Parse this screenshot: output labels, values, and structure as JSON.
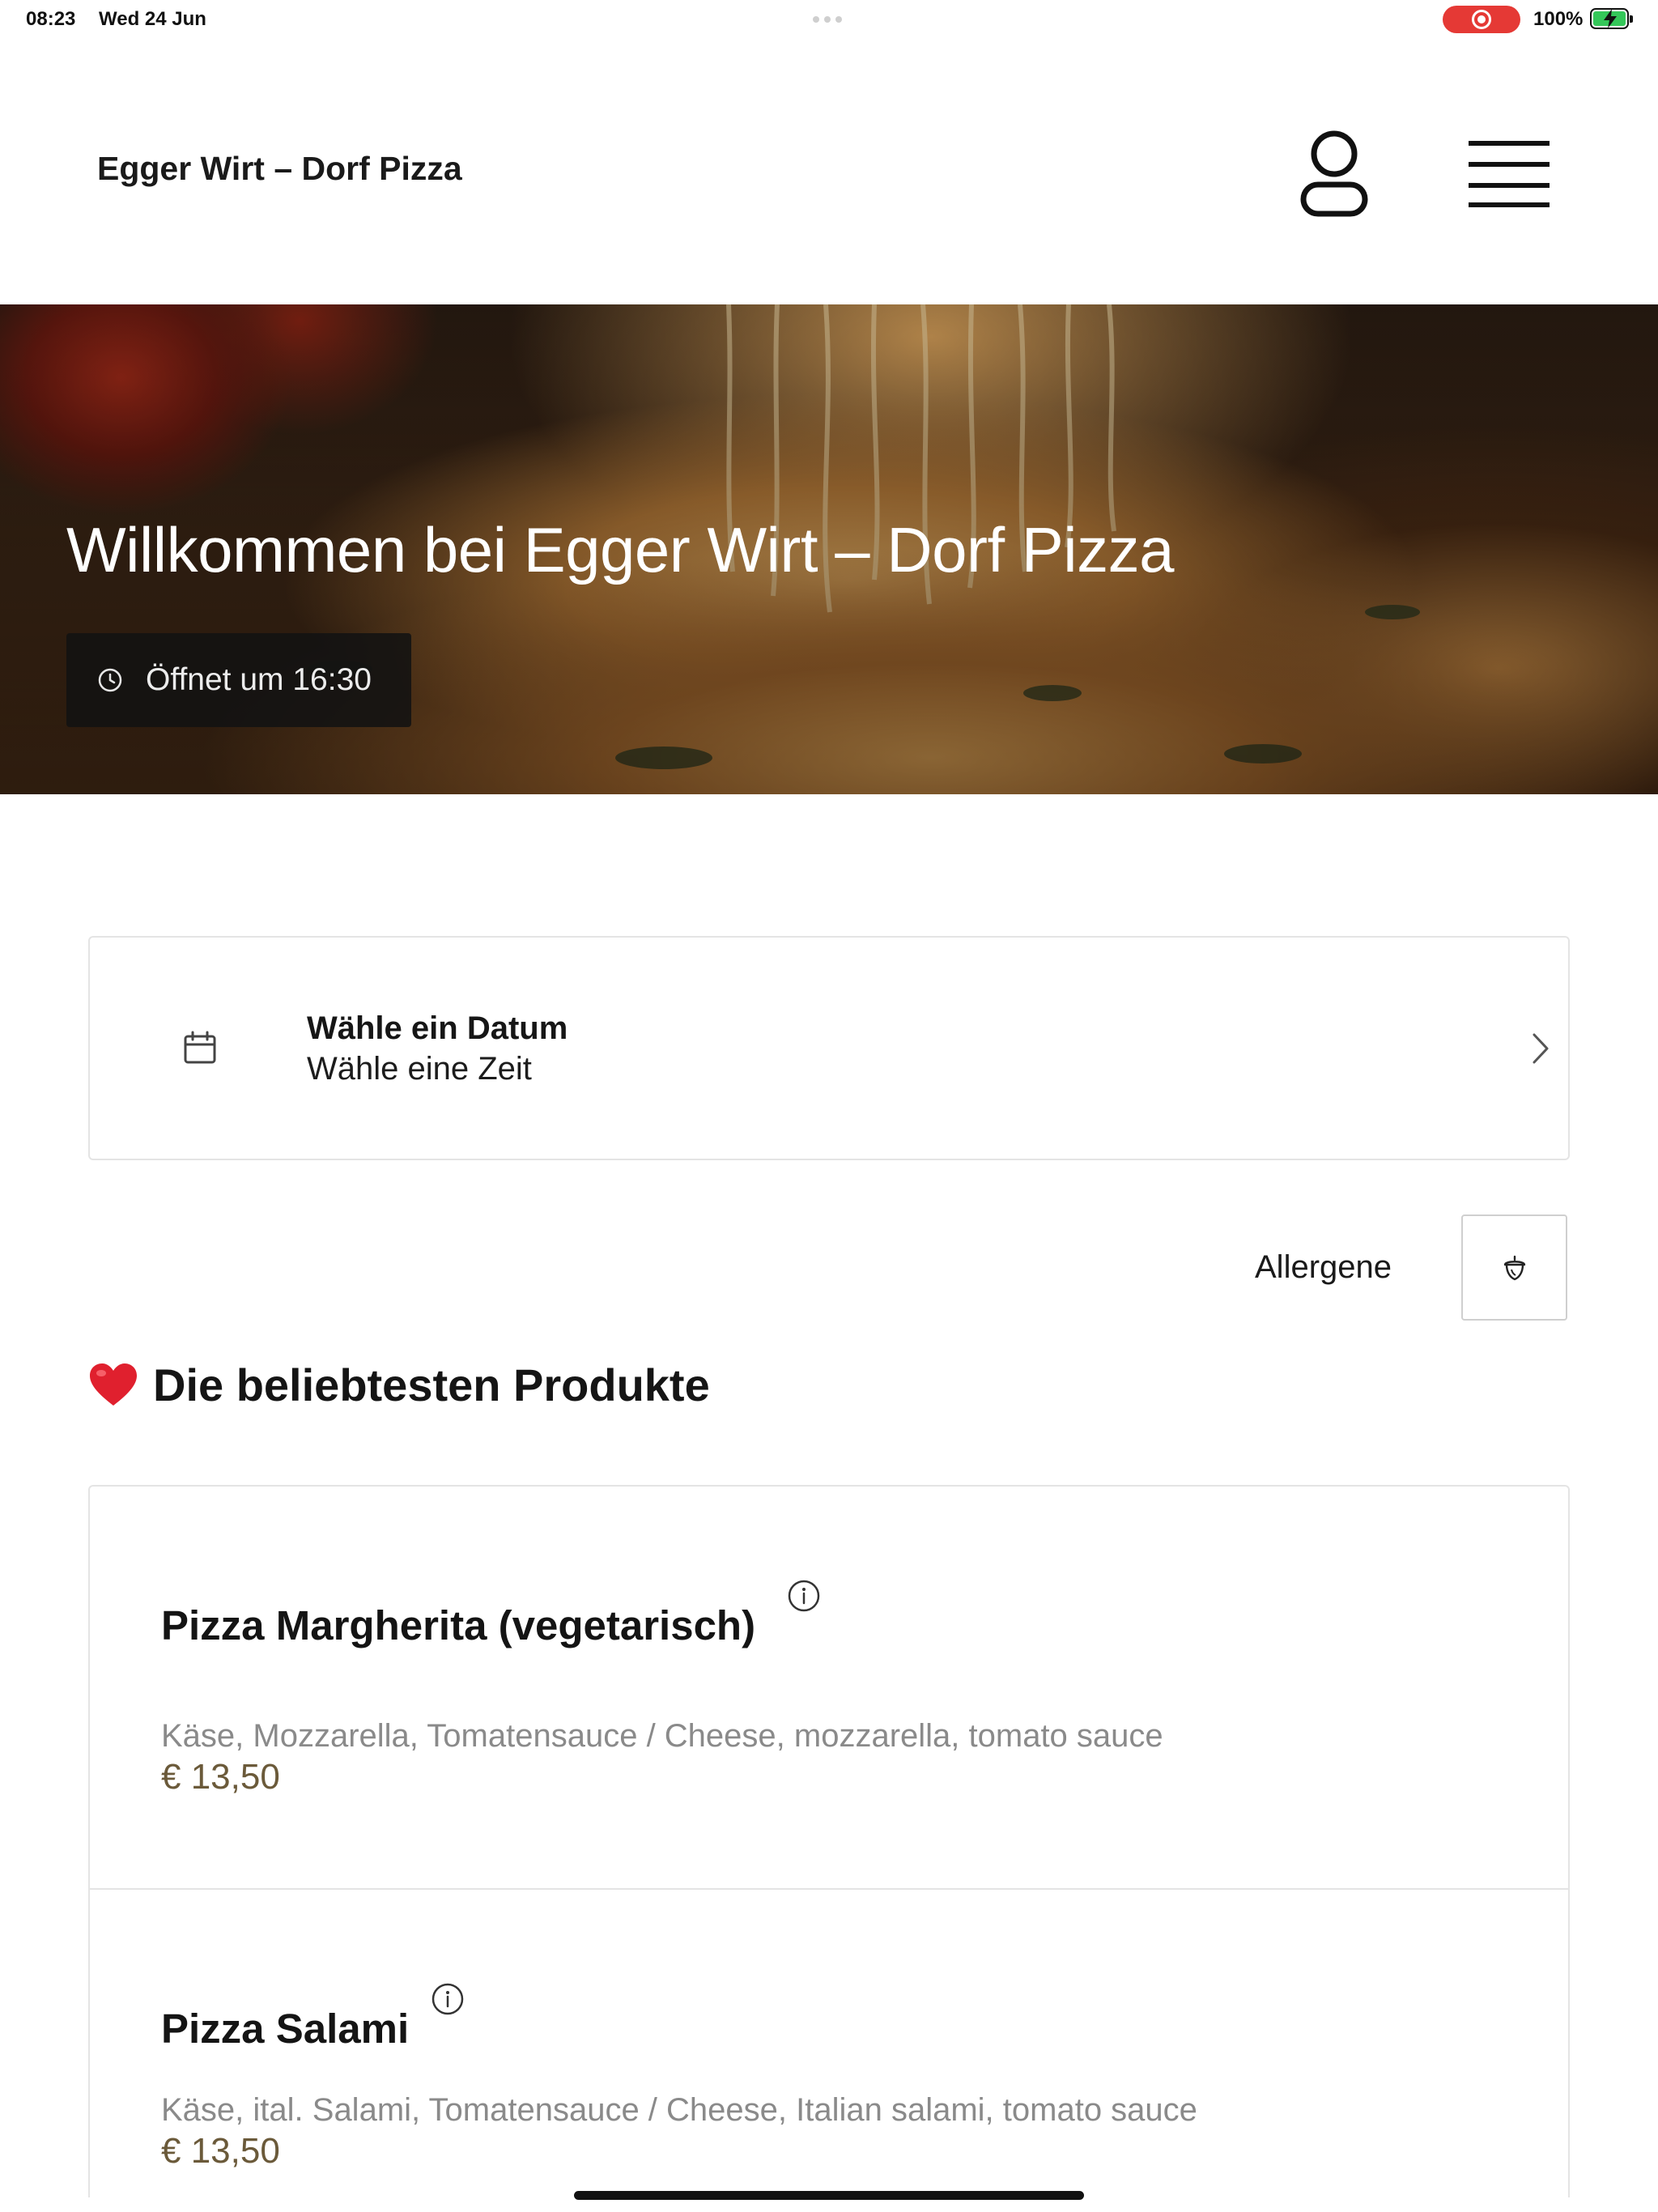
{
  "status_bar": {
    "time": "08:23",
    "date": "Wed 24 Jun",
    "battery": "100%",
    "recording_indicator_color": "#e53935",
    "battery_color": "#34c759"
  },
  "header": {
    "brand": "Egger Wirt – Dorf Pizza",
    "user_icon": "user-icon",
    "menu_icon": "hamburger-menu-icon"
  },
  "hero": {
    "title": "Willkommen bei Egger Wirt – Dorf Pizza",
    "opening_status": "Öffnet um 16:30",
    "opening_icon": "clock-icon"
  },
  "date_picker": {
    "line1": "Wähle ein Datum",
    "line2": "Wähle eine Zeit",
    "icon": "calendar-icon",
    "chevron": "chevron-right-icon"
  },
  "allergens": {
    "label": "Allergene",
    "icon": "acorn-icon"
  },
  "popular": {
    "title": "Die beliebtesten Produkte",
    "icon": "heart-icon",
    "products": [
      {
        "name": "Pizza Margherita (vegetarisch)",
        "description": "Käse, Mozzarella, Tomatensauce / Cheese, mozzarella, tomato sauce",
        "price": "€ 13,50"
      },
      {
        "name": "Pizza Salami",
        "description": "Käse, ital. Salami, Tomatensauce / Cheese, Italian salami, tomato sauce",
        "price": "€ 13,50"
      }
    ]
  },
  "colors": {
    "price": "#6b5a3a",
    "description": "#8a8a8a",
    "heart": "#e0202e"
  }
}
